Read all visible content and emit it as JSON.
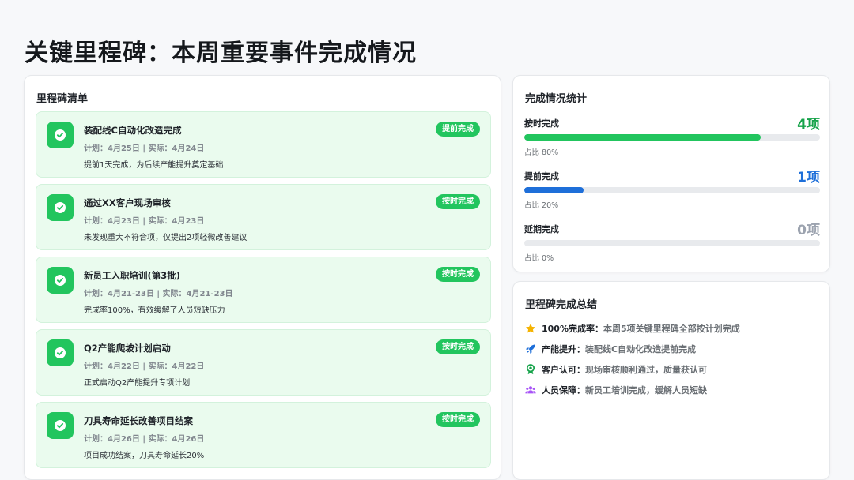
{
  "page": {
    "title": "关键里程碑：本周重要事件完成情况"
  },
  "milestones": {
    "heading": "里程碑清单",
    "items": [
      {
        "title": "装配线C自动化改造完成",
        "dates": "计划：4月25日 | 实际：4月24日",
        "desc": "提前1天完成，为后续产能提升奠定基础",
        "badge": "提前完成"
      },
      {
        "title": "通过XX客户现场审核",
        "dates": "计划：4月23日 | 实际：4月23日",
        "desc": "未发现重大不符合项，仅提出2项轻微改善建议",
        "badge": "按时完成"
      },
      {
        "title": "新员工入职培训(第3批)",
        "dates": "计划：4月21-23日 | 实际：4月21-23日",
        "desc": "完成率100%，有效缓解了人员短缺压力",
        "badge": "按时完成"
      },
      {
        "title": "Q2产能爬坡计划启动",
        "dates": "计划：4月22日 | 实际：4月22日",
        "desc": "正式启动Q2产能提升专项计划",
        "badge": "按时完成"
      },
      {
        "title": "刀具寿命延长改善项目结案",
        "dates": "计划：4月26日 | 实际：4月26日",
        "desc": "项目成功结案，刀具寿命延长20%",
        "badge": "按时完成"
      }
    ]
  },
  "stats": {
    "heading": "完成情况统计",
    "rows": [
      {
        "label": "按时完成",
        "value": "4项",
        "pct_text": "占比 80%",
        "pct": 80,
        "color": "#22c55e",
        "value_color": "#16a34a"
      },
      {
        "label": "提前完成",
        "value": "1项",
        "pct_text": "占比 20%",
        "pct": 20,
        "color": "#1e6fd9",
        "value_color": "#1e6fd9"
      },
      {
        "label": "延期完成",
        "value": "0项",
        "pct_text": "占比 0%",
        "pct": 0,
        "color": "#9ca3af",
        "value_color": "#9ca3af"
      }
    ]
  },
  "summary": {
    "heading": "里程碑完成总结",
    "items": [
      {
        "icon": "star-icon",
        "color": "#f5b301",
        "key": "100%完成率：",
        "text": "本周5项关键里程碑全部按计划完成"
      },
      {
        "icon": "rocket-icon",
        "color": "#1e6fd9",
        "key": "产能提升：",
        "text": "装配线C自动化改造提前完成"
      },
      {
        "icon": "award-icon",
        "color": "#16a34a",
        "key": "客户认可：",
        "text": "现场审核顺利通过，质量获认可"
      },
      {
        "icon": "users-icon",
        "color": "#a855f7",
        "key": "人员保障：",
        "text": "新员工培训完成，缓解人员短缺"
      }
    ]
  }
}
